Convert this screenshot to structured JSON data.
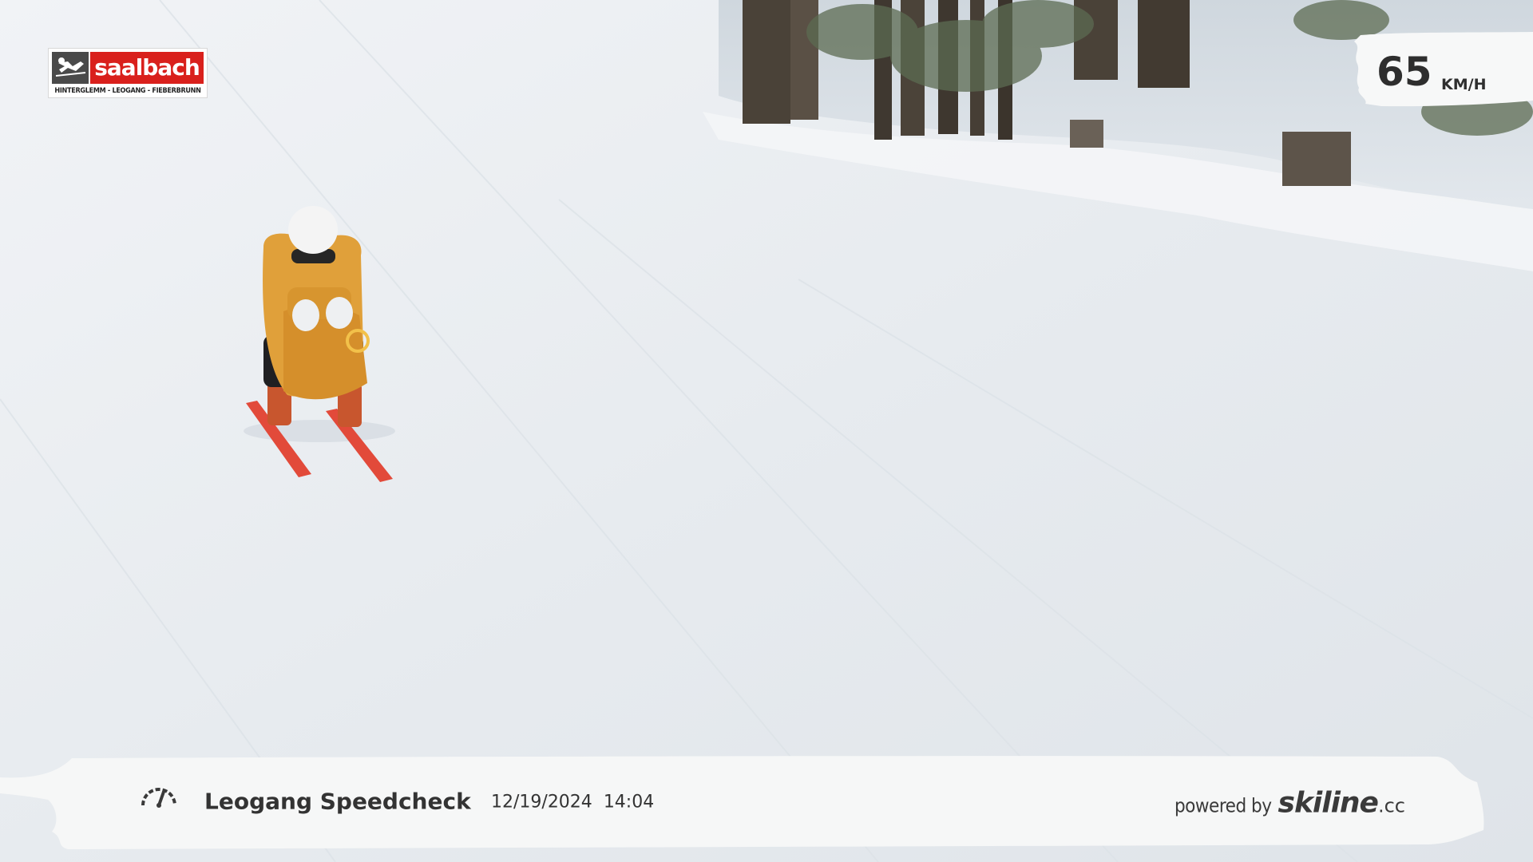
{
  "logo": {
    "name": "saalbach",
    "subtitle": "HINTERGLEMM - LEOGANG - FIEBERBRUNN",
    "brand_color": "#d9201c"
  },
  "speed": {
    "value": "65",
    "unit": "KM/H"
  },
  "footer": {
    "icon": "speedometer-icon",
    "location": "Leogang Speedcheck",
    "date": "12/19/2024",
    "time": "14:04",
    "powered_by": "powered by",
    "brand": "skiline",
    "brand_tld": ".cc"
  },
  "colors": {
    "snow": "#e9edf1",
    "jacket": "#e0a03a",
    "ski": "#e24a3a",
    "text_dark": "#333333"
  }
}
